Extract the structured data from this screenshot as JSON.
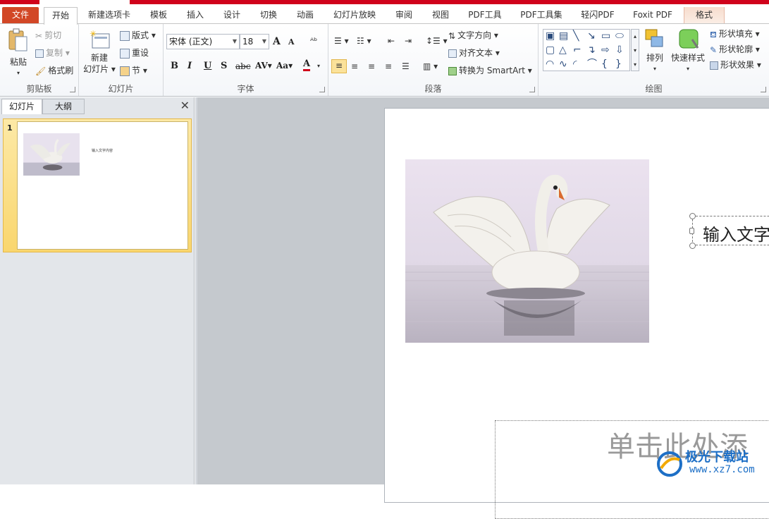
{
  "tabs": [
    "文件",
    "开始",
    "新建选项卡",
    "模板",
    "插入",
    "设计",
    "切换",
    "动画",
    "幻灯片放映",
    "审阅",
    "视图",
    "PDF工具",
    "PDF工具集",
    "轻闪PDF",
    "Foxit PDF",
    "格式"
  ],
  "clipboard": {
    "label": "剪贴板",
    "paste": "粘贴",
    "cut": "剪切",
    "copy": "复制",
    "format_painter": "格式刷"
  },
  "slides_group": {
    "label": "幻灯片",
    "new_slide_line1": "新建",
    "new_slide_line2": "幻灯片",
    "layout": "版式",
    "reset": "重设",
    "section": "节"
  },
  "font": {
    "label": "字体",
    "name": "宋体 (正文)",
    "size": "18",
    "bold": "B",
    "italic": "I",
    "underline": "U",
    "shadow": "S",
    "strike": "abc",
    "spacing": "AV",
    "case": "Aa",
    "color": "A",
    "grow": "A",
    "shrink": "A"
  },
  "paragraph": {
    "label": "段落",
    "text_direction": "文字方向",
    "align_text": "对齐文本",
    "smartart": "转换为 SmartArt"
  },
  "drawing": {
    "label": "绘图",
    "arrange": "排列",
    "quick_styles": "快速样式",
    "shape_fill": "形状填充",
    "shape_outline": "形状轮廓",
    "shape_effects": "形状效果"
  },
  "left_pane": {
    "tab_slides": "幻灯片",
    "tab_outline": "大纲",
    "close": "✕",
    "slide_number": "1",
    "thumb_text": "输入文字内容"
  },
  "slide": {
    "textbox": "输入文字",
    "placeholder": "单击此处添"
  },
  "watermark": {
    "line1": "极光下载站",
    "line2": "www.xz7.com"
  },
  "colors": {
    "accent_red": "#d0021b",
    "file_tab": "#d24726",
    "selection_gold": "#f9d66e"
  }
}
